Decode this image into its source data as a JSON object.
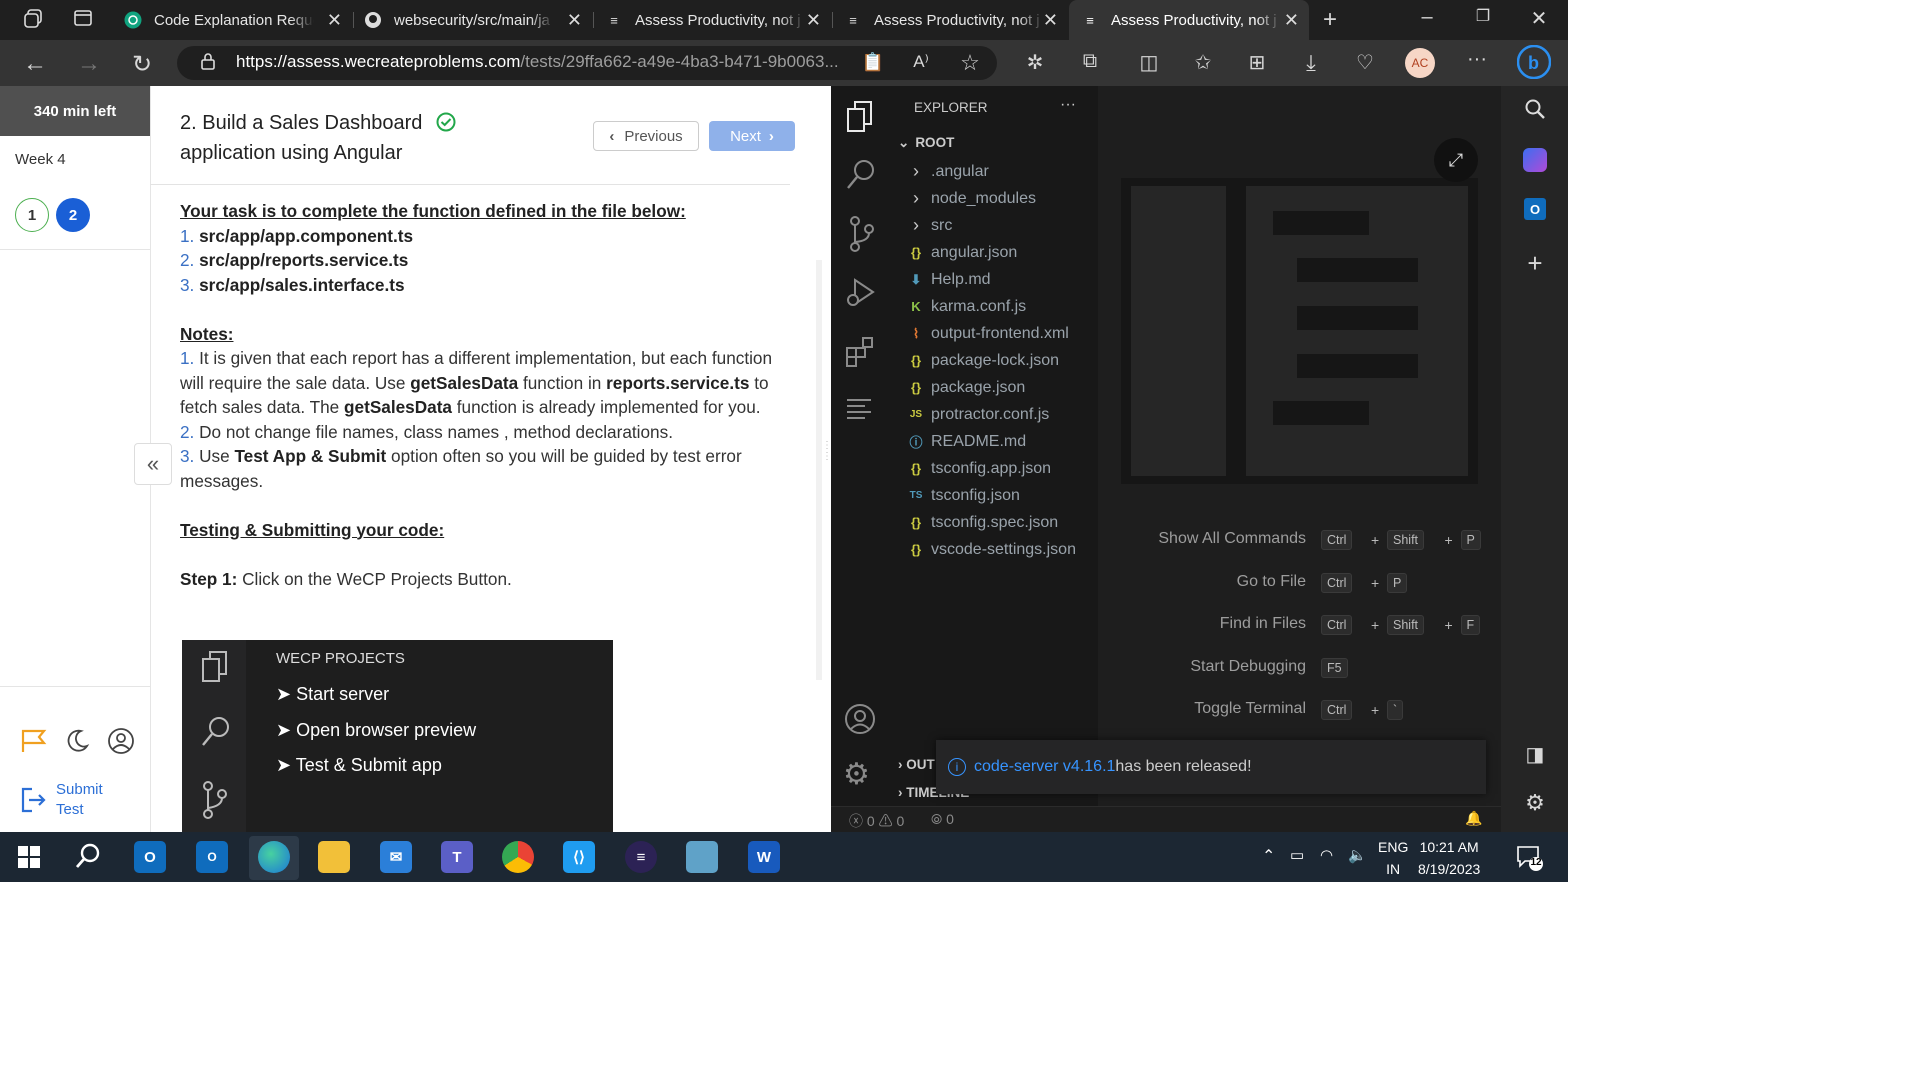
{
  "browser": {
    "tabs": [
      {
        "title": "Code Explanation Reque",
        "icon": "chatgpt-icon"
      },
      {
        "title": "websecurity/src/main/ja",
        "icon": "github-icon"
      },
      {
        "title": "Assess Productivity, not j",
        "icon": "wecp-icon"
      },
      {
        "title": "Assess Productivity, not j",
        "icon": "wecp-icon"
      },
      {
        "title": "Assess Productivity, not j",
        "icon": "wecp-icon",
        "active": true
      }
    ],
    "url_host": "https://assess.wecreateproblems.com",
    "url_path": "/tests/29ffa662-a49e-4ba3-b471-9b0063...",
    "profile_initials": "AC"
  },
  "sidebar": {
    "timer": "340 min left",
    "week": "Week 4",
    "questions": [
      "1",
      "2"
    ],
    "submit_label_1": "Submit",
    "submit_label_2": "Test"
  },
  "question": {
    "title_line1": "2. Build a Sales Dashboard",
    "title_line2": "application using Angular",
    "prev_label": "Previous",
    "next_label": "Next",
    "task_heading": "Your task is to complete the function defined in the file below:",
    "files": [
      "src/app/app.component.ts",
      "src/app/reports.service.ts",
      "src/app/sales.interface.ts"
    ],
    "notes_heading": "Notes:",
    "note1_a": "It is given that each report has a different implementation, but each function will require the sale data. Use ",
    "note1_b": "getSalesData",
    "note1_c": " function in ",
    "note1_d": "reports.service.ts",
    "note1_e": " to fetch sales data. The ",
    "note1_f": "getSalesData",
    "note1_g": " function is already implemented for you.",
    "note2": "Do not change file names, class names , method declarations.",
    "note3_a": "Use ",
    "note3_b": "Test App & Submit",
    "note3_c": " option often so you will be guided by test error messages.",
    "testing_heading": "Testing & Submitting your code:",
    "step1_label": "Step 1:",
    "step1_text": " Click on the WeCP Projects Button.",
    "image": {
      "title": "WECP PROJECTS",
      "items": [
        "Start server",
        "Open browser preview",
        "Test & Submit app"
      ]
    }
  },
  "vscode": {
    "explorer_title": "EXPLORER",
    "root_label": "ROOT",
    "files": [
      {
        "name": ".angular",
        "icon": "chevron-right-icon",
        "color": "#cccccc"
      },
      {
        "name": "node_modules",
        "icon": "chevron-right-icon",
        "color": "#cccccc"
      },
      {
        "name": "src",
        "icon": "chevron-right-icon",
        "color": "#cccccc"
      },
      {
        "name": "angular.json",
        "icon": "json-icon",
        "color": "#cbcb41"
      },
      {
        "name": "Help.md",
        "icon": "download-icon",
        "color": "#519aba"
      },
      {
        "name": "karma.conf.js",
        "icon": "karma-icon",
        "color": "#8dc149"
      },
      {
        "name": "output-frontend.xml",
        "icon": "rss-icon",
        "color": "#e37933"
      },
      {
        "name": "package-lock.json",
        "icon": "json-icon",
        "color": "#cbcb41"
      },
      {
        "name": "package.json",
        "icon": "json-icon",
        "color": "#cbcb41"
      },
      {
        "name": "protractor.conf.js",
        "icon": "js-icon",
        "color": "#cbcb41"
      },
      {
        "name": "README.md",
        "icon": "info-icon",
        "color": "#519aba"
      },
      {
        "name": "tsconfig.app.json",
        "icon": "json-icon",
        "color": "#cbcb41"
      },
      {
        "name": "tsconfig.json",
        "icon": "ts-icon",
        "color": "#519aba"
      },
      {
        "name": "tsconfig.spec.json",
        "icon": "json-icon",
        "color": "#cbcb41"
      },
      {
        "name": "vscode-settings.json",
        "icon": "json-icon",
        "color": "#cbcb41"
      }
    ],
    "outline_label": "OUT",
    "timeline_label": "TIMELINE",
    "commands": [
      {
        "label": "Show All Commands",
        "keys": [
          "Ctrl",
          "Shift",
          "P"
        ]
      },
      {
        "label": "Go to File",
        "keys": [
          "Ctrl",
          "P"
        ]
      },
      {
        "label": "Find in Files",
        "keys": [
          "Ctrl",
          "Shift",
          "F"
        ]
      },
      {
        "label": "Start Debugging",
        "keys": [
          "F5"
        ]
      },
      {
        "label": "Toggle Terminal",
        "keys": [
          "Ctrl",
          "`"
        ]
      }
    ],
    "notification_link": "code-server v4.16.1",
    "notification_text": " has been released!",
    "status_errors": "0",
    "status_warnings": "0",
    "status_ports": "0"
  },
  "taskbar": {
    "lang_1": "ENG",
    "lang_2": "IN",
    "time": "10:21 AM",
    "date": "8/19/2023",
    "notifications": "12"
  }
}
